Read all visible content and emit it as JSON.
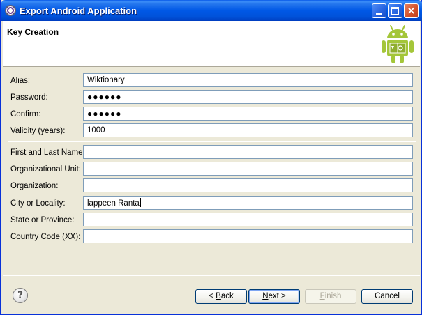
{
  "window": {
    "title": "Export Android Application",
    "icon": "eclipse-icon",
    "controls": {
      "minimize": "minimize-icon",
      "maximize": "maximize-icon",
      "close": "×"
    }
  },
  "header": {
    "title": "Key Creation",
    "logo": "android-robot-icon"
  },
  "form": {
    "alias": {
      "label": "Alias:",
      "value": "Wiktionary"
    },
    "password": {
      "label": "Password:",
      "value": "●●●●●●"
    },
    "confirm": {
      "label": "Confirm:",
      "value": "●●●●●●"
    },
    "validity": {
      "label": "Validity (years):",
      "value": "1000"
    },
    "name": {
      "label": "First and Last Name:",
      "value": ""
    },
    "unit": {
      "label": "Organizational Unit:",
      "value": ""
    },
    "organization": {
      "label": "Organization:",
      "value": ""
    },
    "city": {
      "label": "City or Locality:",
      "value": "lappeen Ranta"
    },
    "state": {
      "label": "State or Province:",
      "value": ""
    },
    "country": {
      "label": "Country Code (XX):",
      "value": ""
    }
  },
  "footer": {
    "help": "?",
    "back": {
      "prefix": "< ",
      "mnemonic": "B",
      "rest": "ack"
    },
    "next": {
      "mnemonic": "N",
      "rest": "ext >"
    },
    "finish": {
      "mnemonic": "F",
      "rest": "inish"
    },
    "cancel": "Cancel"
  },
  "colors": {
    "titlebar": "#0058E6",
    "window_bg": "#ECE9D8",
    "android_green": "#A4C639",
    "field_border": "#7F9DB9"
  }
}
